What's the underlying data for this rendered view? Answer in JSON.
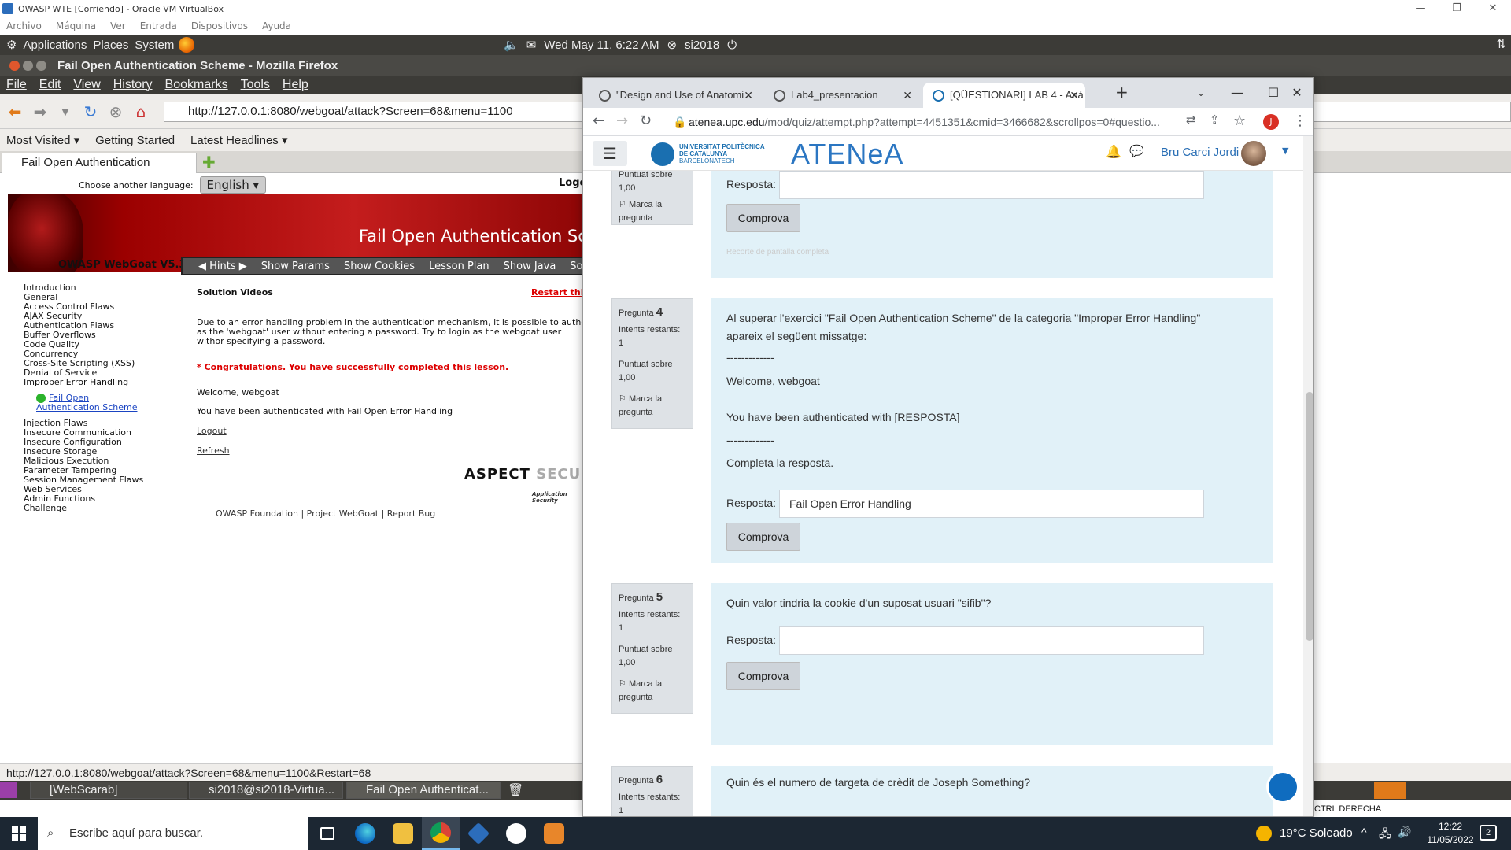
{
  "vbox": {
    "title": "OWASP WTE [Corriendo] - Oracle VM VirtualBox",
    "menu": [
      "Archivo",
      "Máquina",
      "Ver",
      "Entrada",
      "Dispositivos",
      "Ayuda"
    ],
    "tray_text": "CTRL DERECHA"
  },
  "gnome": {
    "applications": "Applications",
    "places": "Places",
    "system": "System",
    "datetime": "Wed May 11,  6:22 AM",
    "user": "si2018"
  },
  "firefox": {
    "title": "Fail Open Authentication Scheme - Mozilla Firefox",
    "menu": [
      "File",
      "Edit",
      "View",
      "History",
      "Bookmarks",
      "Tools",
      "Help"
    ],
    "url": "http://127.0.0.1:8080/webgoat/attack?Screen=68&menu=1100",
    "bookmarks": [
      "Most Visited",
      "Getting Started",
      "Latest Headlines"
    ],
    "tab": "Fail Open Authentication Scheme",
    "status": "http://127.0.0.1:8080/webgoat/attack?Screen=68&menu=1100&Restart=68"
  },
  "webgoat": {
    "choose_language": "Choose another language:",
    "language": "English",
    "logout_top": "Logo",
    "banner_title": "Fail Open Authentication Sch",
    "brand": "OWASP WebGoat V5.3",
    "nav": [
      "Hints",
      "Show Params",
      "Show Cookies",
      "Lesson Plan",
      "Show Java",
      "Solutio"
    ],
    "sidebar_before": [
      "Introduction",
      "General",
      "Access Control Flaws",
      "AJAX Security",
      "Authentication Flaws",
      "Buffer Overflows",
      "Code Quality",
      "Concurrency",
      "Cross-Site Scripting (XSS)",
      "Denial of Service",
      "Improper Error Handling"
    ],
    "sidebar_sub": "Fail Open Authentication Scheme",
    "sidebar_after": [
      "Injection Flaws",
      "Insecure Communication",
      "Insecure Configuration",
      "Insecure Storage",
      "Malicious Execution",
      "Parameter Tampering",
      "Session Management Flaws",
      "Web Services",
      "Admin Functions",
      "Challenge"
    ],
    "solution_videos": "Solution Videos",
    "restart": "Restart thi",
    "description": "Due to an error handling problem in the authentication mechanism, it is possible to auther as the 'webgoat' user without entering a password. Try to login as the webgoat user withor specifying a password.",
    "congrats": "* Congratulations. You have successfully completed this lesson.",
    "welcome": "Welcome, webgoat",
    "authenticated": "You have been authenticated with Fail Open Error Handling",
    "logout": "Logout",
    "refresh": "Refresh",
    "aspect": "ASPECT",
    "secur": "SECUR",
    "aspect_sub": "Application Security",
    "footer": "OWASP Foundation | Project WebGoat | Report Bug"
  },
  "gnome_tasks": [
    "[WebScarab]",
    "si2018@si2018-Virtua...",
    "Fail Open Authenticat..."
  ],
  "chrome": {
    "tabs": [
      "\"Design and Use of Anatomi",
      "Lab4_presentacion",
      "[QÜESTIONARI] LAB 4 - Aná"
    ],
    "url_host": "atenea.upc.edu",
    "url_path": "/mod/quiz/attempt.php?attempt=4451351&cmid=3466682&scrollpos=0#questio...",
    "profile": "J"
  },
  "atenea": {
    "upc_lines": [
      "UNIVERSITAT POLITÈCNICA",
      "DE CATALUNYA",
      "BARCELONATECH"
    ],
    "brand": "ATENeA",
    "user": "Bru Carci Jordi",
    "ghost_text": "Recorte de pantalla completa",
    "q3": {
      "info": [
        "Puntuat sobre",
        "1,00",
        "Marca la",
        "pregunta"
      ],
      "label": "Resposta:",
      "value": "",
      "button": "Comprova"
    },
    "q4": {
      "pregunta": "Pregunta",
      "num": "4",
      "info": [
        "Intents restants:",
        "1",
        "Puntuat sobre",
        "1,00",
        "Marca la",
        "pregunta"
      ],
      "text": [
        "Al superar l'exercici \"Fail Open Authentication Scheme\" de la categoria \"Improper Error Handling\"",
        "apareix el següent missatge:",
        "-------------",
        "Welcome, webgoat",
        "You have been authenticated with  [RESPOSTA]",
        "-------------",
        "Completa la resposta."
      ],
      "label": "Resposta:",
      "value": "Fail Open Error Handling",
      "button": "Comprova"
    },
    "q5": {
      "pregunta": "Pregunta",
      "num": "5",
      "info": [
        "Intents restants:",
        "1",
        "Puntuat sobre",
        "1,00",
        "Marca la",
        "pregunta"
      ],
      "text": "Quin valor tindria la cookie d'un suposat usuari \"sifib\"?",
      "label": "Resposta:",
      "value": "",
      "button": "Comprova"
    },
    "q6": {
      "pregunta": "Pregunta",
      "num": "6",
      "info": [
        "Intents restants:",
        "1"
      ],
      "text": "Quin és el numero de targeta de crèdit de Joseph Something?"
    }
  },
  "windows": {
    "search_placeholder": "Escribe aquí para buscar.",
    "weather": "19°C  Soleado",
    "time": "12:22",
    "date": "11/05/2022",
    "notifications": "2"
  }
}
